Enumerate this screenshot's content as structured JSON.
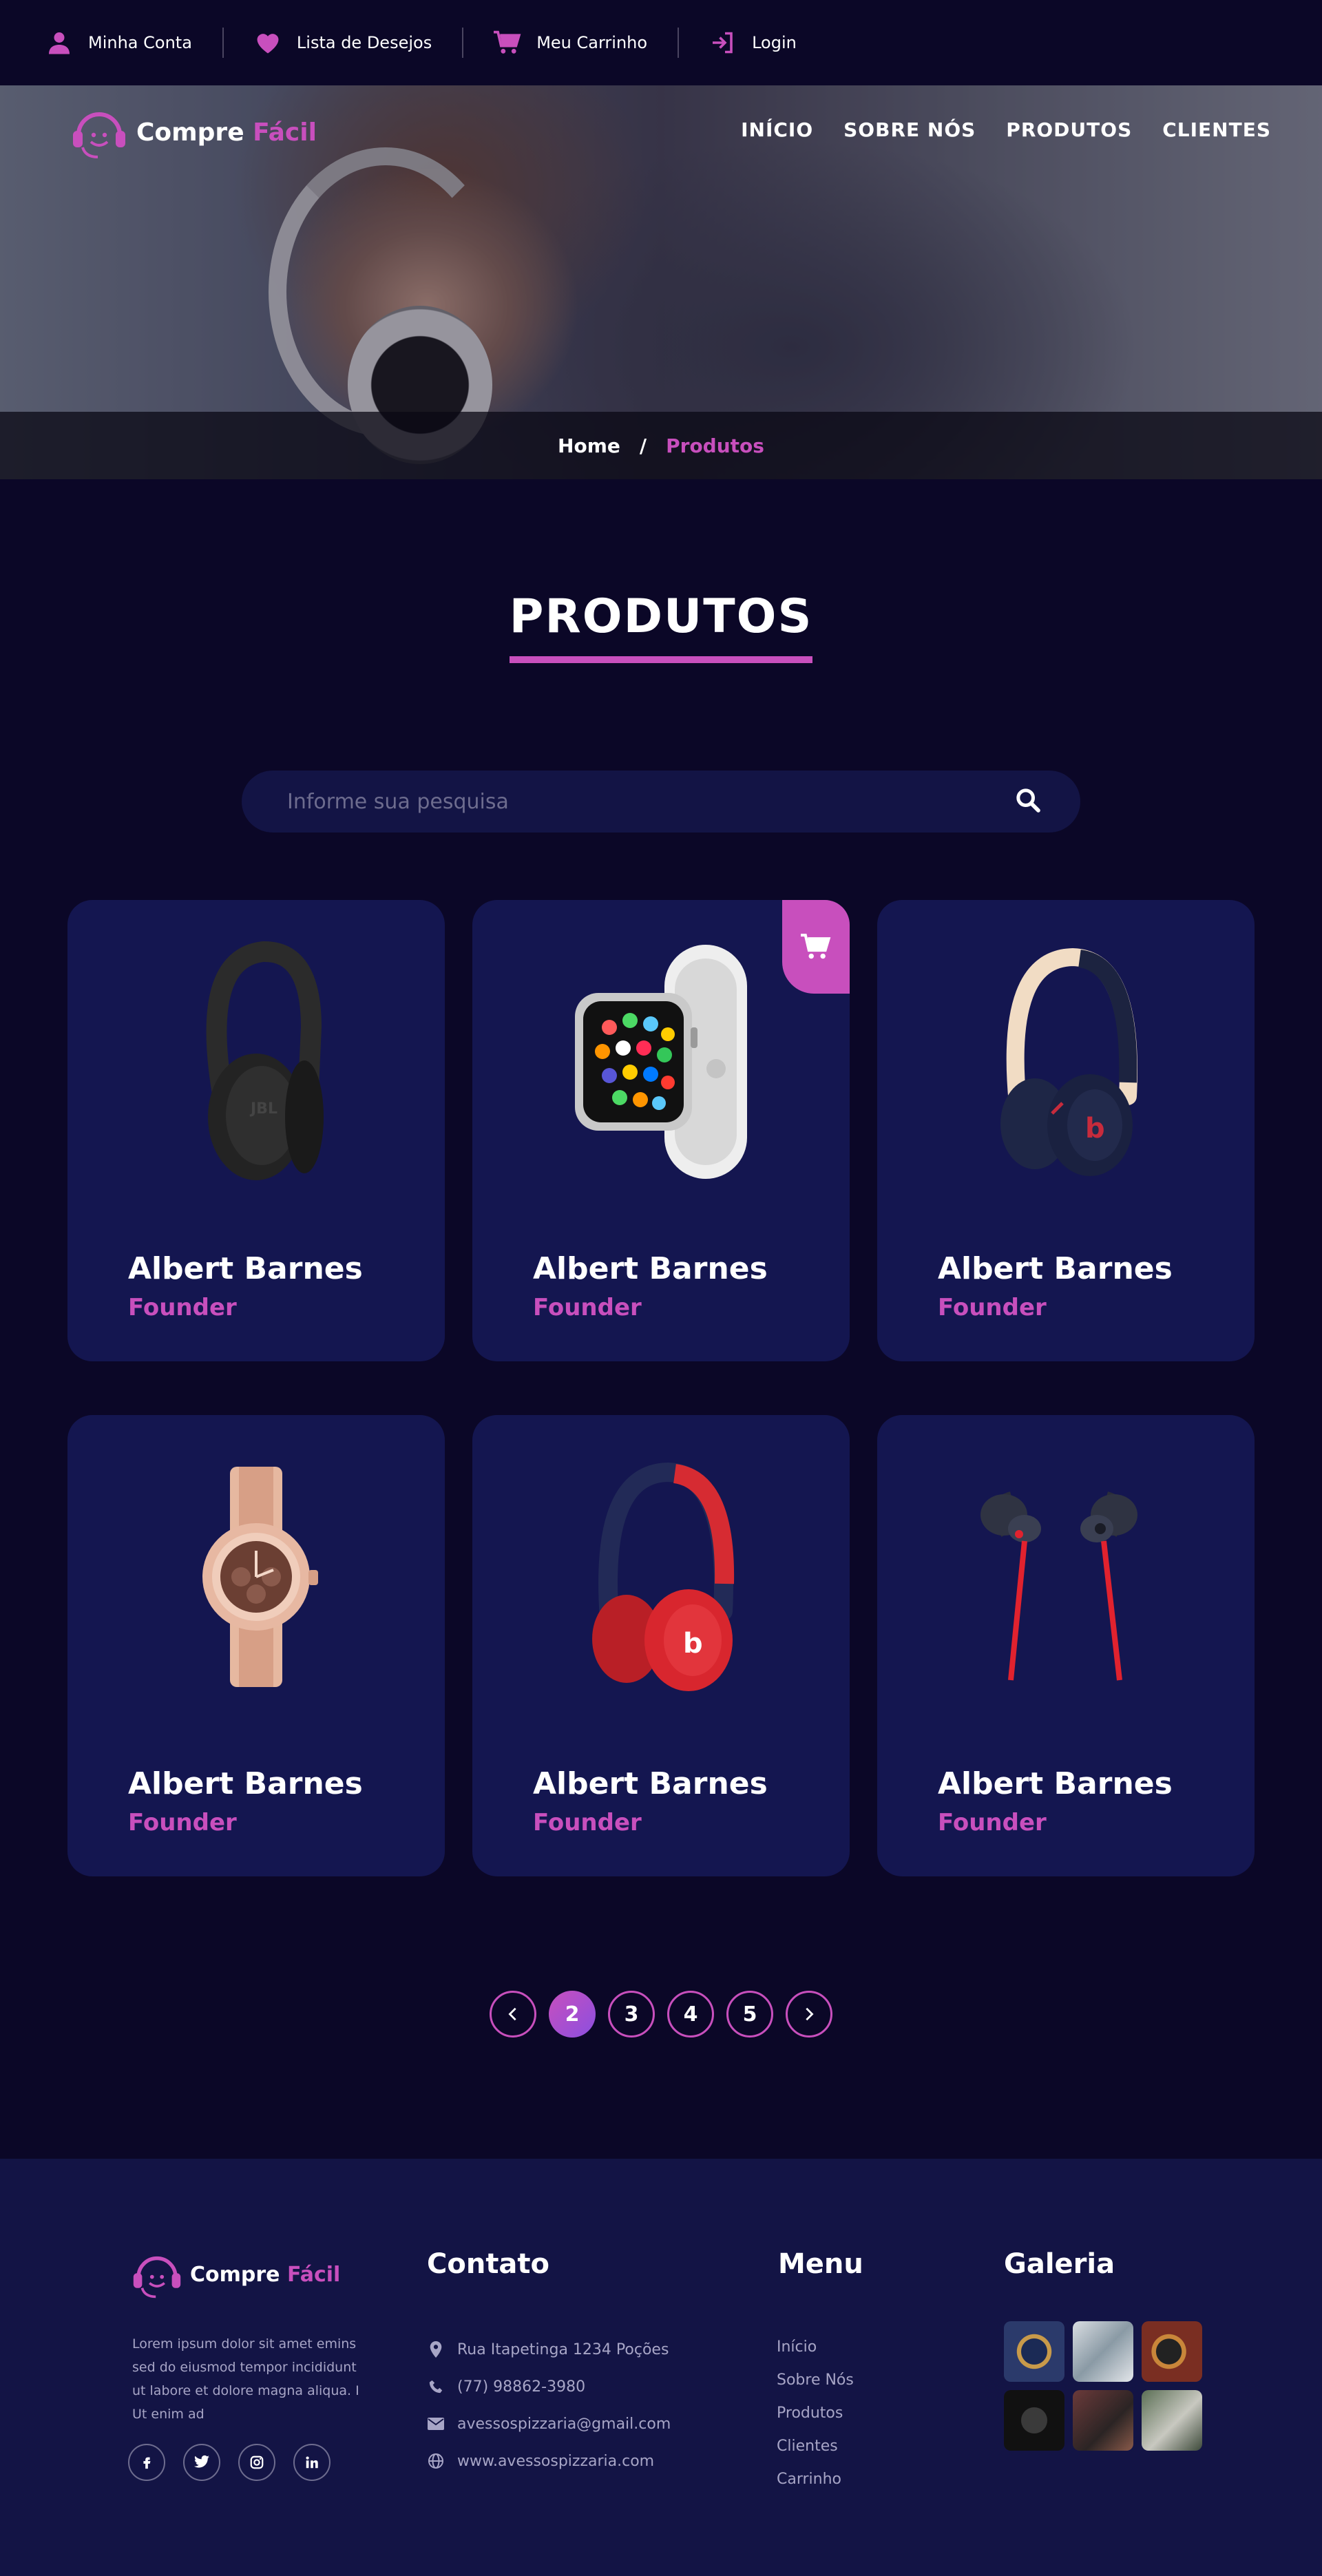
{
  "topbar": {
    "items": [
      {
        "label": "Minha Conta",
        "icon": "user-icon"
      },
      {
        "label": "Lista de Desejos",
        "icon": "heart-icon"
      },
      {
        "label": "Meu Carrinho",
        "icon": "cart-icon"
      },
      {
        "label": "Login",
        "icon": "login-icon"
      }
    ]
  },
  "brand": {
    "name_a": "Compre",
    "name_b": "Fácil",
    "accent": "#c84fbd"
  },
  "nav": [
    "INÍCIO",
    "SOBRE NÓS",
    "PRODUTOS",
    "CLIENTES"
  ],
  "breadcrumb": {
    "home": "Home",
    "sep": "/",
    "current": "Produtos"
  },
  "section": {
    "title": "PRODUTOS"
  },
  "search": {
    "placeholder": "Informe sua pesquisa"
  },
  "products": [
    {
      "name": "Albert Barnes",
      "role": "Founder",
      "image": "jbl-headphones"
    },
    {
      "name": "Albert Barnes",
      "role": "Founder",
      "image": "apple-watch"
    },
    {
      "name": "Albert Barnes",
      "role": "Founder",
      "image": "beats-headphones-navy"
    },
    {
      "name": "Albert Barnes",
      "role": "Founder",
      "image": "rose-gold-watch"
    },
    {
      "name": "Albert Barnes",
      "role": "Founder",
      "image": "beats-headphones-red"
    },
    {
      "name": "Albert Barnes",
      "role": "Founder",
      "image": "wireless-earbuds"
    }
  ],
  "pagination": {
    "prev": "‹",
    "pages": [
      "2",
      "3",
      "4",
      "5"
    ],
    "active": "2",
    "next": "›"
  },
  "footer": {
    "about": "Lorem ipsum dolor sit amet emins sed do eiusmod tempor incididunt ut labore et dolore magna aliqua. I Ut enim ad",
    "socials": [
      "f",
      "t",
      "ig",
      "in"
    ],
    "contact_title": "Contato",
    "contact": [
      {
        "icon": "map-pin-icon",
        "text": "Rua Itapetinga 1234 Poções"
      },
      {
        "icon": "phone-icon",
        "text": "(77) 98862-3980"
      },
      {
        "icon": "mail-icon",
        "text": "avessospizzaria@gmail.com"
      },
      {
        "icon": "globe-icon",
        "text": "www.avessospizzaria.com"
      }
    ],
    "menu_title": "Menu",
    "menu": [
      "Início",
      "Sobre Nós",
      "Produtos",
      "Clientes",
      "Carrinho"
    ],
    "gallery_title": "Galeria"
  }
}
